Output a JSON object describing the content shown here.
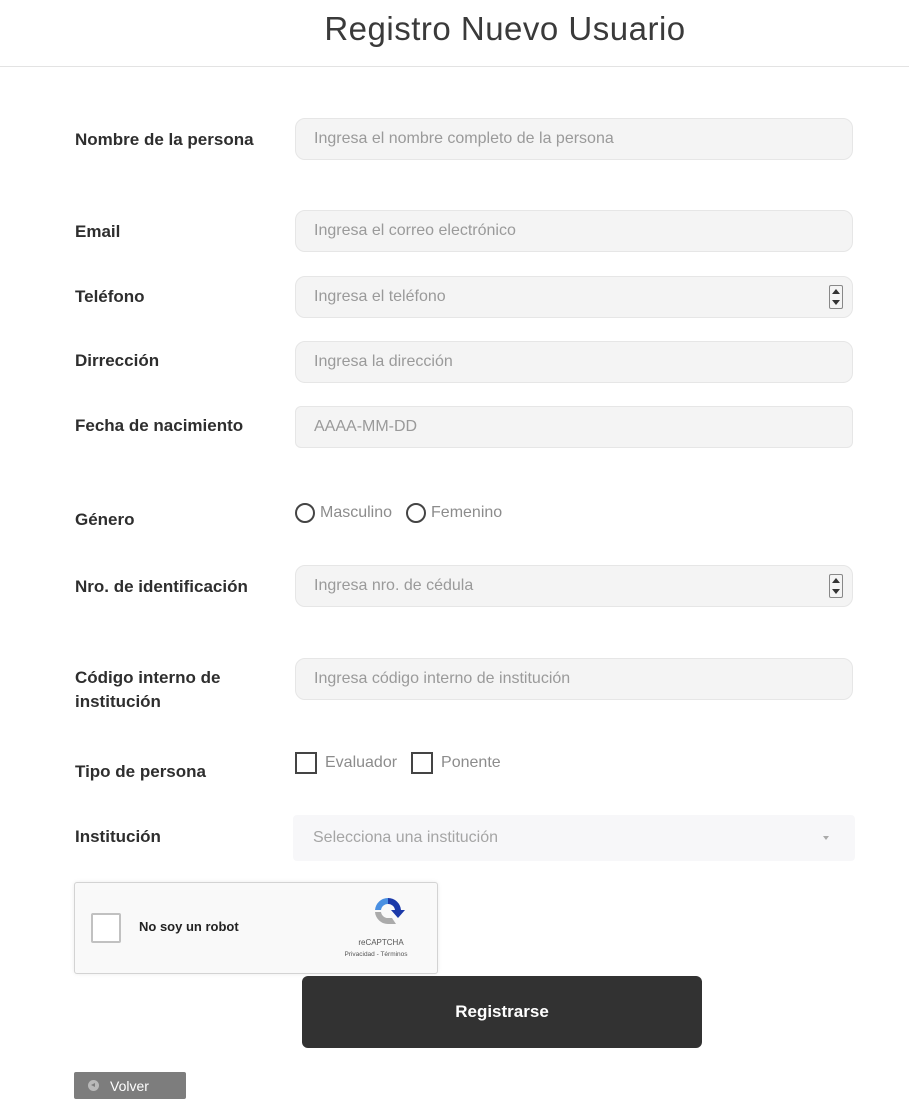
{
  "header": {
    "title": "Registro Nuevo Usuario"
  },
  "form": {
    "name": {
      "label": "Nombre de la persona",
      "placeholder": "Ingresa el nombre completo de la persona",
      "value": ""
    },
    "email": {
      "label": "Email",
      "placeholder": "Ingresa el correo electrónico",
      "value": ""
    },
    "phone": {
      "label": "Teléfono",
      "placeholder": "Ingresa el teléfono",
      "value": ""
    },
    "address": {
      "label": "Dirrección",
      "placeholder": "Ingresa la dirección",
      "value": ""
    },
    "birthdate": {
      "label": "Fecha de nacimiento",
      "placeholder": "AAAA-MM-DD",
      "value": ""
    },
    "gender": {
      "label": "Género",
      "options": [
        "Masculino",
        "Femenino"
      ],
      "selected": null
    },
    "id_number": {
      "label": "Nro. de identificación",
      "placeholder": "Ingresa nro. de cédula",
      "value": ""
    },
    "internal_code": {
      "label": "Código interno de institución",
      "placeholder": "Ingresa código interno de institución",
      "value": ""
    },
    "person_type": {
      "label": "Tipo de persona",
      "options": [
        "Evaluador",
        "Ponente"
      ],
      "checked": []
    },
    "institution": {
      "label": "Institución",
      "placeholder": "Selecciona una institución"
    }
  },
  "recaptcha": {
    "label": "No soy un robot",
    "brand": "reCAPTCHA",
    "terms": "Privacidad - Términos"
  },
  "actions": {
    "submit_label": "Registrarse",
    "back_label": "Volver"
  },
  "colors": {
    "button_bg": "#323232",
    "back_bg": "#7d7d7d",
    "field_bg": "#f4f4f4"
  }
}
